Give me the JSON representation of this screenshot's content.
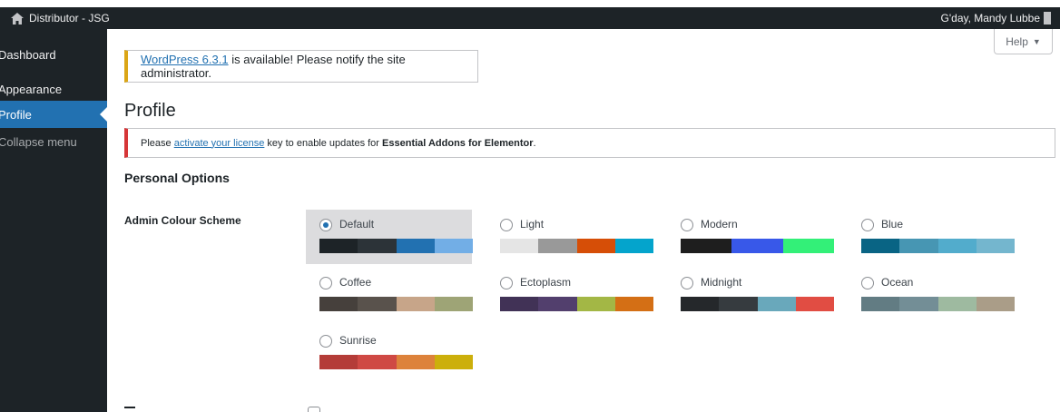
{
  "admin_bar": {
    "site_name": "Distributor - JSG",
    "greeting": "G'day, Mandy Lubbe",
    "home_icon": "home-icon"
  },
  "menu": {
    "items": [
      {
        "label": "Dashboard"
      },
      {
        "label": "Appearance"
      },
      {
        "label": "Profile",
        "current": true
      },
      {
        "label": "Collapse menu"
      }
    ]
  },
  "help": {
    "label": "Help",
    "arrow": "▼"
  },
  "update_nag": {
    "link": "WordPress 6.3.1",
    "text": " is available! Please notify the site administrator."
  },
  "page_title": "Profile",
  "license_notice": {
    "prefix": "Please ",
    "link": "activate your license",
    "middle": " key to enable updates for ",
    "strong": "Essential Addons for Elementor",
    "suffix": "."
  },
  "personal_options": {
    "title": "Personal Options",
    "color_scheme_label": "Admin Colour Scheme",
    "schemes": [
      {
        "name": "Default",
        "selected": true,
        "colors": [
          "#1d2327",
          "#2c3338",
          "#2271b1",
          "#72aee6"
        ]
      },
      {
        "name": "Light",
        "selected": false,
        "colors": [
          "#e5e5e5",
          "#999999",
          "#d64e07",
          "#04a4cc"
        ]
      },
      {
        "name": "Modern",
        "selected": false,
        "colors": [
          "#1e1e1e",
          "#3858e9",
          "#33f078"
        ]
      },
      {
        "name": "Blue",
        "selected": false,
        "colors": [
          "#096484",
          "#4796b3",
          "#52accc",
          "#74b6ce"
        ]
      },
      {
        "name": "Coffee",
        "selected": false,
        "colors": [
          "#46403c",
          "#59524c",
          "#c7a589",
          "#9ea476"
        ]
      },
      {
        "name": "Ectoplasm",
        "selected": false,
        "colors": [
          "#413256",
          "#523f6d",
          "#a3b745",
          "#d46f15"
        ]
      },
      {
        "name": "Midnight",
        "selected": false,
        "colors": [
          "#25282b",
          "#363b3f",
          "#69a8bb",
          "#e14d43"
        ]
      },
      {
        "name": "Ocean",
        "selected": false,
        "colors": [
          "#627c83",
          "#738e96",
          "#9ebaa0",
          "#aa9d88"
        ]
      },
      {
        "name": "Sunrise",
        "selected": false,
        "colors": [
          "#b43c38",
          "#cf4944",
          "#dd823b",
          "#ccaf0b"
        ]
      }
    ]
  },
  "colors": {
    "admin_bar": "#1d2327",
    "menu_current": "#2271b1",
    "link": "#2271b1",
    "warning_border": "#dba617",
    "error_border": "#d63638"
  }
}
